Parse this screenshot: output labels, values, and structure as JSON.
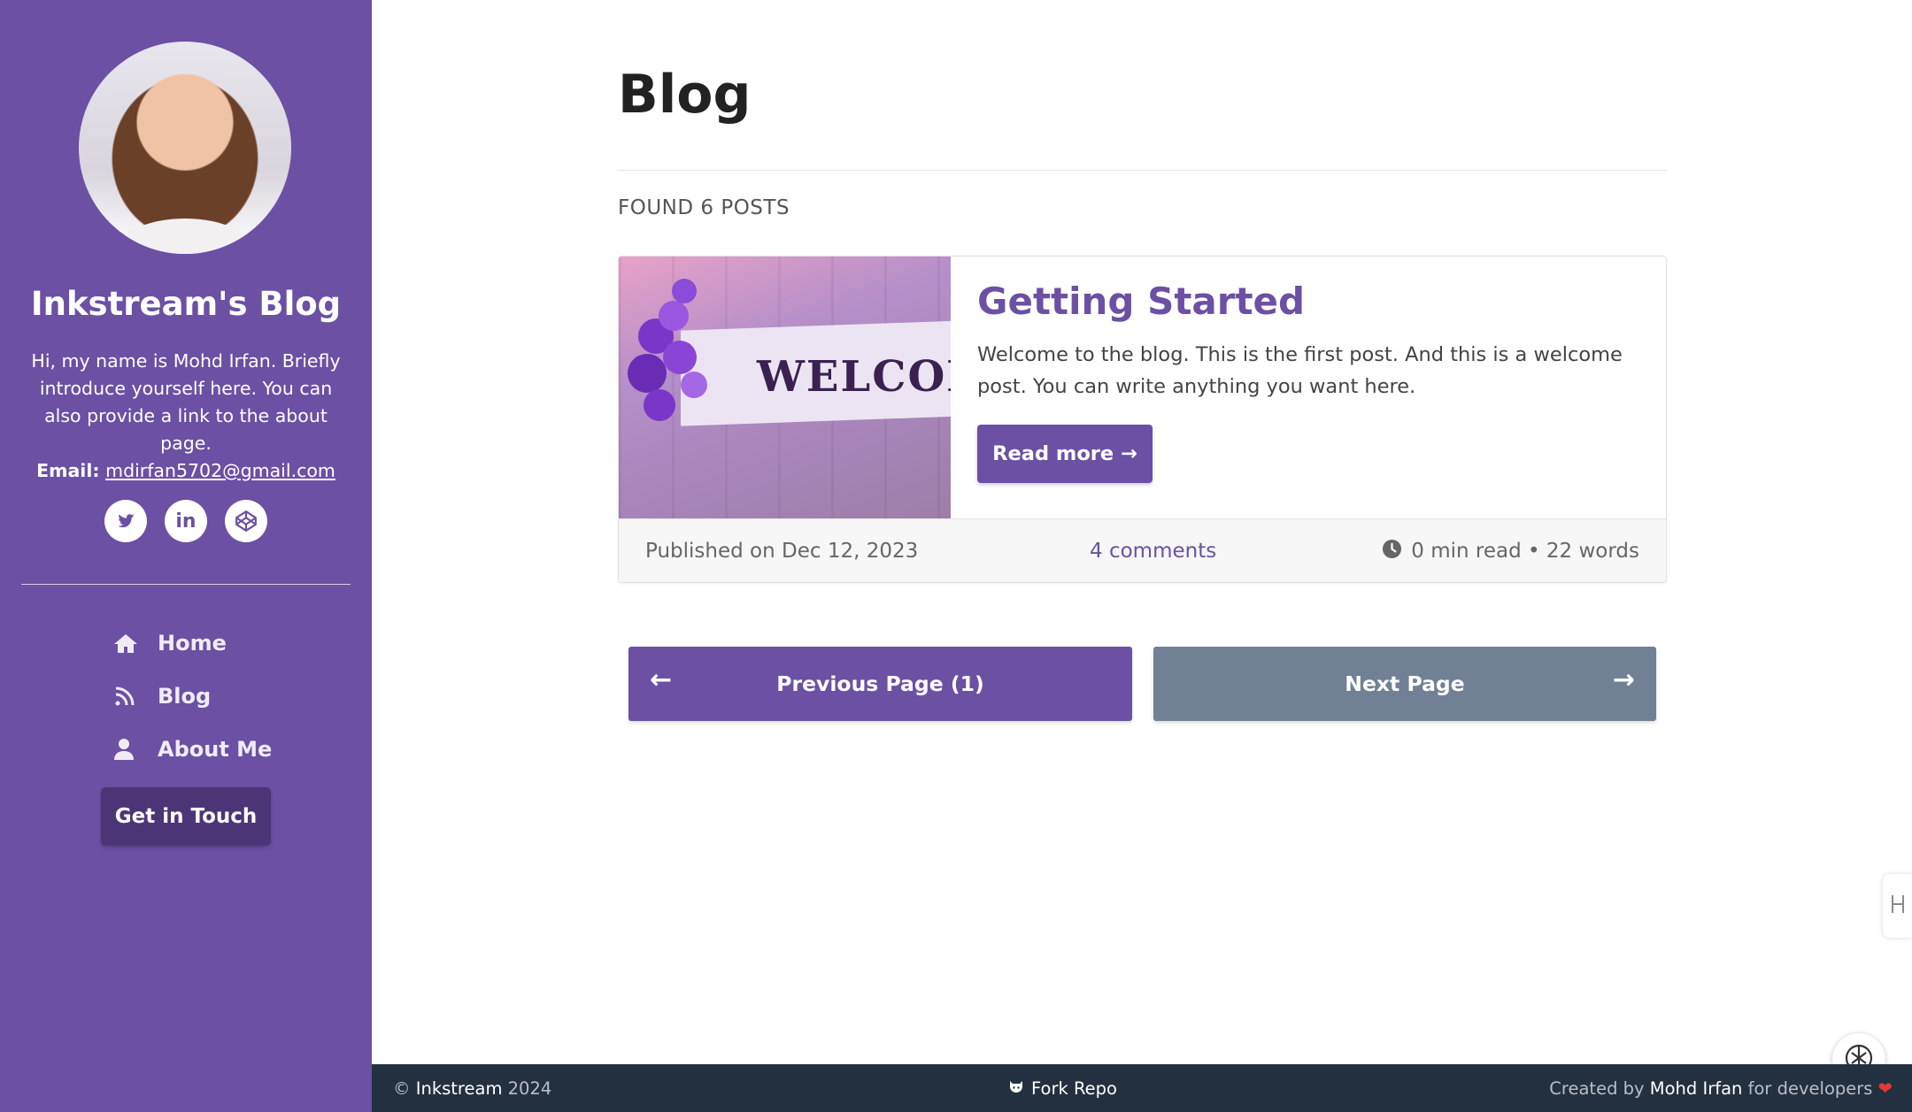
{
  "sidebar": {
    "site_title": "Inkstream's Blog",
    "bio": "Hi, my name is Mohd Irfan. Briefly introduce yourself here. You can also provide a link to the about page.",
    "email_label": "Email:",
    "email": " mdirfan5702@gmail.com",
    "socials": [
      {
        "icon": "twitter-icon"
      },
      {
        "icon": "linkedin-icon",
        "glyph": "in"
      },
      {
        "icon": "codepen-icon"
      }
    ],
    "nav": [
      {
        "label": "Home",
        "icon": "home-icon"
      },
      {
        "label": "Blog",
        "icon": "rss-icon"
      },
      {
        "label": "About Me",
        "icon": "user-icon"
      }
    ],
    "cta": "Get in Touch"
  },
  "main": {
    "title": "Blog",
    "found": "FOUND 6 POSTS",
    "posts": [
      {
        "thumb_text": "WELCOM",
        "title": "Getting Started",
        "excerpt": "Welcome to the blog. This is the first post. And this is a welcome post. You can write anything you want here.",
        "read_more": "Read more →",
        "published": "Published on Dec 12, 2023",
        "comments": "4 comments",
        "read_meta": "0 min read • 22 words"
      }
    ],
    "pagination": {
      "prev_label": "Previous Page (1)",
      "prev_arrow": "←",
      "next_label": "Next Page",
      "next_arrow": "→"
    }
  },
  "footer": {
    "copyright_symbol": "©",
    "brand": "Inkstream",
    "year": " 2024",
    "fork": "Fork Repo",
    "created_prefix": "Created by ",
    "author": "Mohd Irfan",
    "created_suffix": " for developers"
  },
  "colors": {
    "accent": "#6c50a4",
    "cta_dark": "#4b3577",
    "next_button": "#718095",
    "footer_bg": "#23303f"
  }
}
